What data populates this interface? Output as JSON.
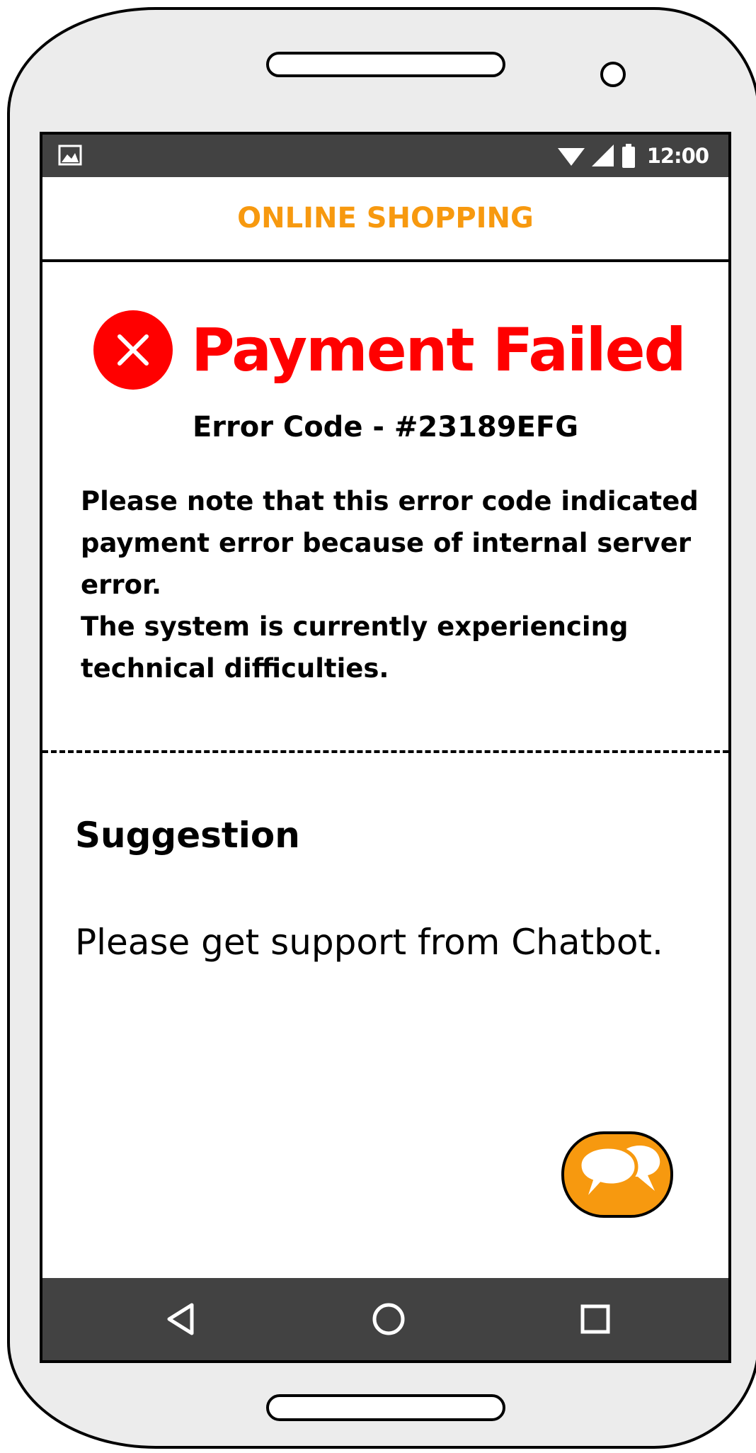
{
  "status_bar": {
    "time": "12:00",
    "icons": [
      "image-icon",
      "wifi-icon",
      "signal-icon",
      "battery-icon"
    ]
  },
  "header": {
    "title": "ONLINE SHOPPING",
    "title_color": "#f7990f"
  },
  "error": {
    "title": "Payment Failed",
    "icon": "error-x-icon",
    "color": "#ff0000",
    "code_line": "Error Code - #23189EFG",
    "message_line_1": "Please note that this error code indicated payment error because of internal server error.",
    "message_line_2": "The system is currently experiencing technical difficulties."
  },
  "suggestion": {
    "title": "Suggestion",
    "text": "Please get support from Chatbot."
  },
  "chat_button": {
    "icon": "chat-bubbles-icon",
    "color": "#f7990f"
  },
  "nav_bar": {
    "buttons": [
      "back-icon",
      "home-icon",
      "recents-icon"
    ],
    "background": "#424242"
  }
}
